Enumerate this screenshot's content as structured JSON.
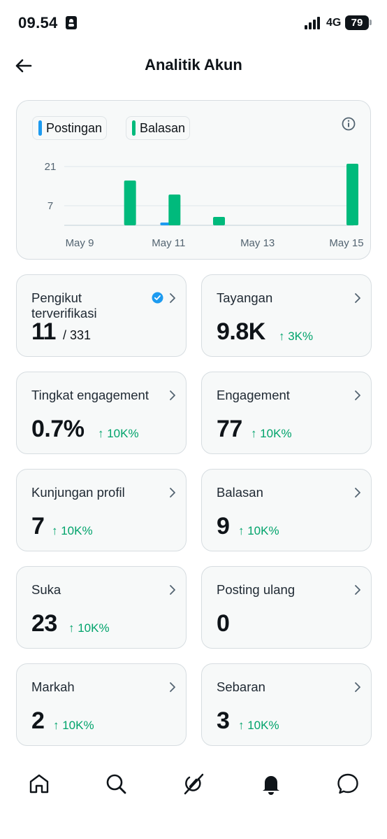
{
  "status_bar": {
    "time": "09.54",
    "network": "4G",
    "battery": "79"
  },
  "header": {
    "title": "Analitik Akun"
  },
  "chart": {
    "legend": [
      {
        "label": "Postingan",
        "color": "#1d9bf0"
      },
      {
        "label": "Balasan",
        "color": "#00ba7c"
      }
    ]
  },
  "chart_data": {
    "type": "bar",
    "categories": [
      "May 9",
      "May 10",
      "May 11",
      "May 12",
      "May 13",
      "May 14",
      "May 15"
    ],
    "x_tick_labels": [
      "May 9",
      "May 11",
      "May 13",
      "May 15"
    ],
    "y_tick_labels": [
      "21",
      "7"
    ],
    "ylim": [
      0,
      26
    ],
    "grid": true,
    "legend_position": "top-left",
    "series": [
      {
        "name": "Postingan",
        "color": "#1d9bf0",
        "values": [
          0,
          0,
          1,
          0,
          0,
          0,
          0
        ]
      },
      {
        "name": "Balasan",
        "color": "#00ba7c",
        "values": [
          0,
          16,
          11,
          3,
          0,
          0,
          22
        ]
      }
    ]
  },
  "metrics": [
    {
      "label": "Pengikut terverifikasi",
      "value": "11",
      "sub": "/ 331",
      "verified": true
    },
    {
      "label": "Tayangan",
      "value": "9.8K",
      "delta": "↑ 3K%"
    },
    {
      "label": "Tingkat engagement",
      "value": "0.7%",
      "delta": "↑ 10K%"
    },
    {
      "label": "Engagement",
      "value": "77",
      "delta": "↑ 10K%"
    },
    {
      "label": "Kunjungan profil",
      "value": "7",
      "delta": "↑ 10K%"
    },
    {
      "label": "Balasan",
      "value": "9",
      "delta": "↑ 10K%"
    },
    {
      "label": "Suka",
      "value": "23",
      "delta": "↑ 10K%"
    },
    {
      "label": "Posting ulang",
      "value": "0"
    },
    {
      "label": "Markah",
      "value": "2",
      "delta": "↑ 10K%"
    },
    {
      "label": "Sebaran",
      "value": "3",
      "delta": "↑ 10K%"
    }
  ],
  "bottom_nav": [
    {
      "icon": "home-icon"
    },
    {
      "icon": "search-icon"
    },
    {
      "icon": "grok-icon"
    },
    {
      "icon": "bell-icon"
    },
    {
      "icon": "messages-icon"
    }
  ]
}
